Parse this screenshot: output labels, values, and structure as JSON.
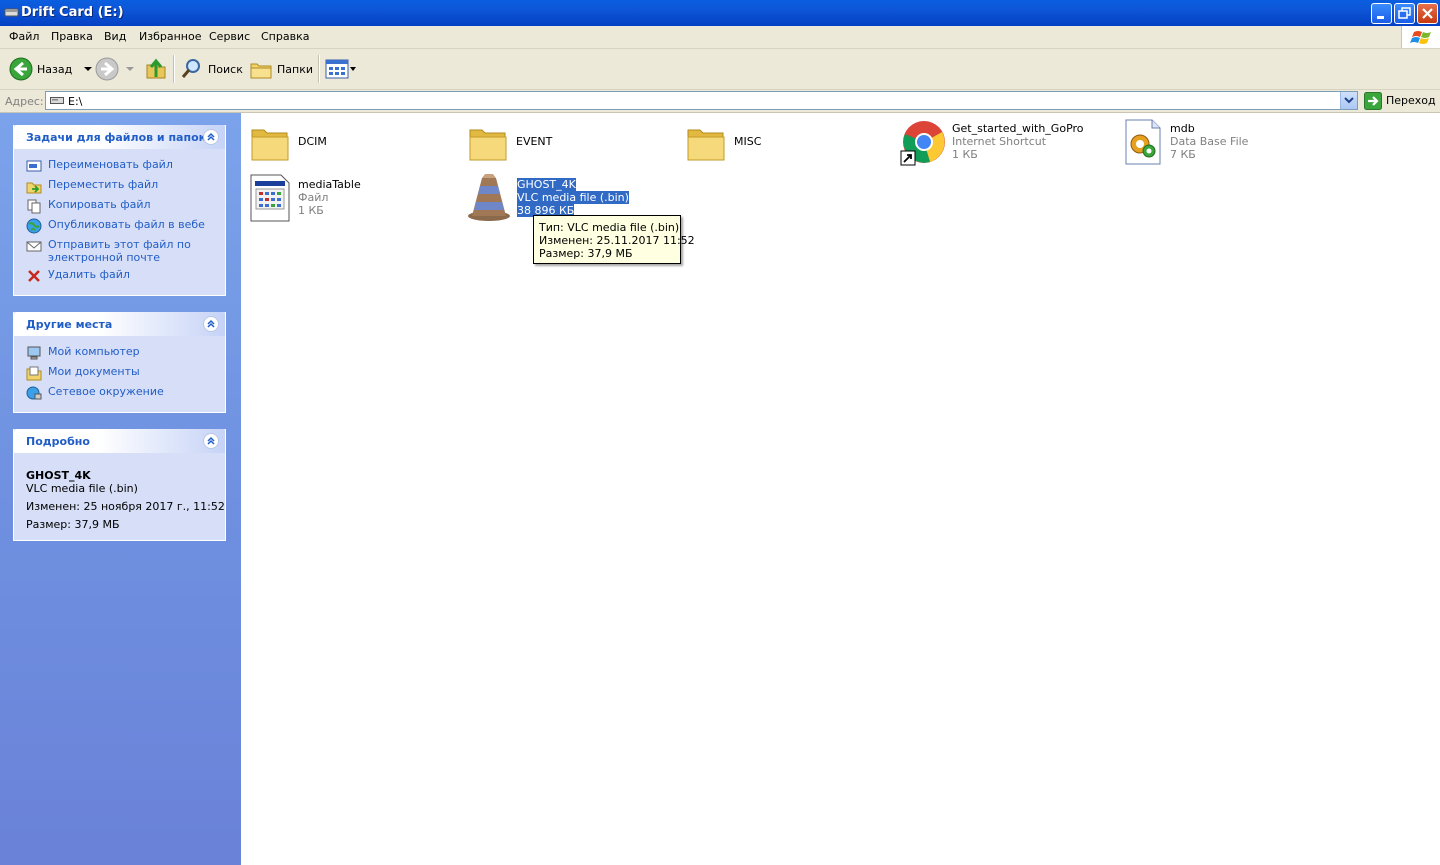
{
  "window": {
    "title": "Drift Card (E:)"
  },
  "menu": [
    "Файл",
    "Правка",
    "Вид",
    "Избранное",
    "Сервис",
    "Справка"
  ],
  "toolbar": {
    "back_label": "Назад",
    "search_label": "Поиск",
    "folders_label": "Папки"
  },
  "address": {
    "label": "Адрес:",
    "value": "E:\\",
    "go_label": "Переход"
  },
  "tasks_panel": {
    "title": "Задачи для файлов и папок",
    "items": [
      {
        "label": "Переименовать файл",
        "icon": "rename-icon"
      },
      {
        "label": "Переместить файл",
        "icon": "move-icon"
      },
      {
        "label": "Копировать файл",
        "icon": "copy-icon"
      },
      {
        "label": "Опубликовать файл в вебе",
        "icon": "web-publish-icon"
      },
      {
        "label": "Отправить этот файл по электронной почте",
        "icon": "email-icon"
      },
      {
        "label": "Удалить файл",
        "icon": "delete-icon"
      }
    ]
  },
  "places_panel": {
    "title": "Другие места",
    "items": [
      {
        "label": "Мой компьютер",
        "icon": "my-computer-icon"
      },
      {
        "label": "Мои документы",
        "icon": "my-documents-icon"
      },
      {
        "label": "Сетевое окружение",
        "icon": "network-icon"
      }
    ]
  },
  "details_panel": {
    "title": "Подробно",
    "name": "GHOST_4K",
    "type": "VLC media file (.bin)",
    "modified": "Изменен: 25 ноября 2017 г., 11:52",
    "size": "Размер: 37,9 МБ"
  },
  "files": [
    {
      "name": "DCIM",
      "icon": "folder-icon"
    },
    {
      "name": "EVENT",
      "icon": "folder-icon"
    },
    {
      "name": "MISC",
      "icon": "folder-icon"
    },
    {
      "name": "Get_started_with_GoPro",
      "type": "Internet Shortcut",
      "size": "1 КБ",
      "icon": "chrome-shortcut-icon"
    },
    {
      "name": "mdb",
      "type": "Data Base File",
      "size": "7 КБ",
      "icon": "database-file-icon"
    },
    {
      "name": "mediaTable",
      "type": "Файл",
      "size": "1 КБ",
      "icon": "generic-file-icon"
    },
    {
      "name": "GHOST_4K",
      "type": "VLC media file (.bin)",
      "size": "38 896 КБ",
      "icon": "vlc-icon",
      "selected": true
    }
  ],
  "tooltip": {
    "type": "Тип: VLC media file (.bin)",
    "modified": "Изменен: 25.11.2017 11:52",
    "size": "Размер: 37,9 МБ"
  }
}
